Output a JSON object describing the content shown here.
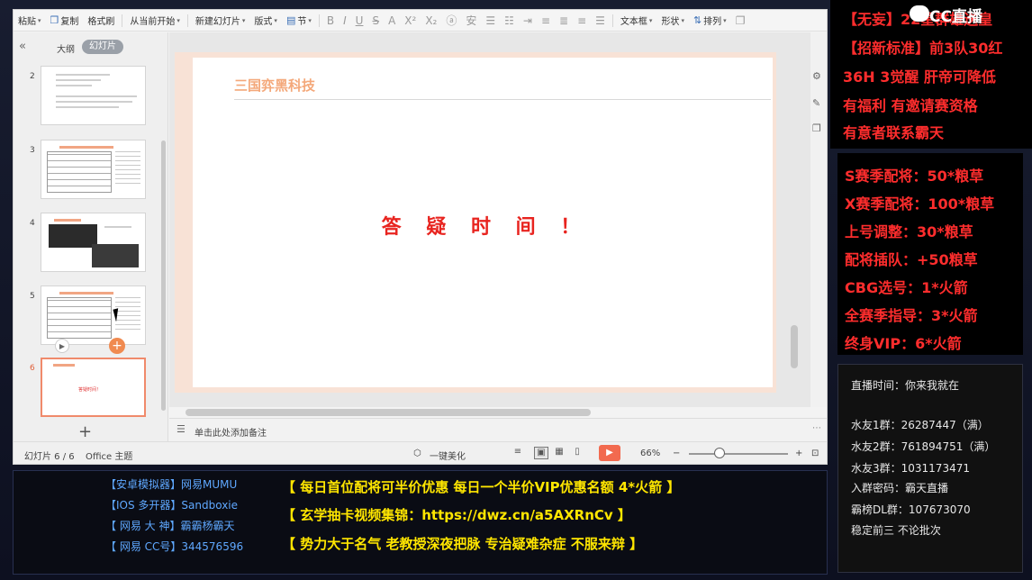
{
  "toolbar": {
    "items": [
      "粘贴",
      "复制",
      "格式刷",
      "从当前开始",
      "新建幻灯片",
      "版式",
      "节"
    ],
    "format_icons": [
      "B",
      "I",
      "U",
      "S",
      "A",
      "X²",
      "X₂",
      "ⓐ",
      "安"
    ],
    "right_items": [
      "文本框",
      "形状",
      "排列"
    ]
  },
  "left_panel": {
    "tab_outline": "大纲",
    "tab_slides": "幻灯片",
    "slide_numbers": [
      "2",
      "3",
      "4",
      "5",
      "6"
    ],
    "thumb6_text": "答疑时间！"
  },
  "slide": {
    "company": "三国弈黑科技",
    "heading": "答 疑 时 间 ！"
  },
  "notes": {
    "placeholder": "单击此处添加备注"
  },
  "status": {
    "slide_count": "幻灯片 6 / 6",
    "theme": "Office 主题",
    "beautify": "一键美化",
    "zoom": "66%"
  },
  "overlay_top": {
    "line1": "【无妄】22星群雄送皇",
    "line2": "【招新标准】前3队30红",
    "line3": "36H 3觉醒 肝帝可降低",
    "line4": "有福利 有邀请赛资格",
    "line5": "有意者联系霸天",
    "logo": "CC直播"
  },
  "overlay_price": [
    "S赛季配将：50*粮草",
    "X赛季配将：100*粮草",
    "上号调整：30*粮草",
    "配将插队：+50粮草",
    "CBG选号：1*火箭",
    "全赛季指导：3*火箭",
    "终身VIP：6*火箭"
  ],
  "overlay_info": [
    "直播时间：你来我就在",
    "水友1群：26287447（满）",
    "水友2群：761894751（满）",
    "水友3群：1031173471",
    "入群密码：霸天直播",
    "霸榜DL群：107673070",
    "稳定前三     不论批次"
  ],
  "overlay_bottom_left": [
    "【安卓模拟器】网易MUMU",
    "【IOS 多开器】Sandboxie",
    "【 网易  大 神】霸霸杨霸天",
    "【 网易  CC号】344576596"
  ],
  "overlay_bottom_right": [
    "【 每日首位配将可半价优惠 每日一个半价VIP优惠名额 4*火箭 】",
    "【        玄学抽卡视频集锦：https://dwz.cn/a5AXRnCv       】",
    "【  势力大于名气  老教授深夜把脉   专治疑难杂症   不服来辩   】"
  ]
}
